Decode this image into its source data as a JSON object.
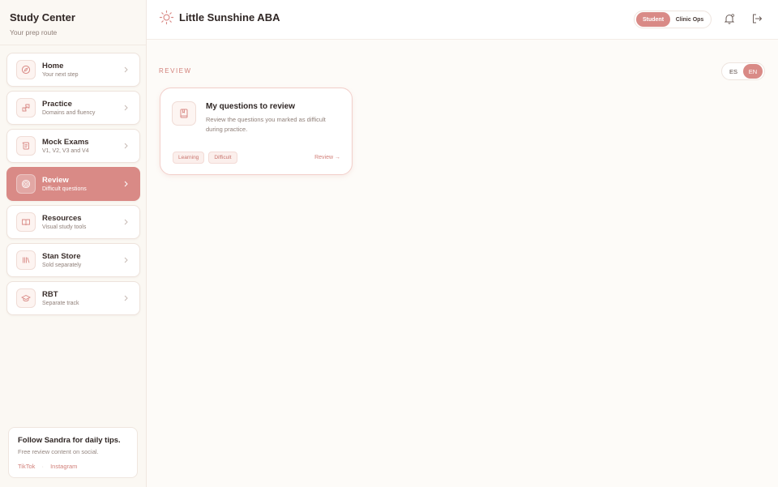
{
  "sidebar": {
    "title": "Study Center",
    "subtitle": "Your prep route",
    "items": [
      {
        "label": "Home",
        "desc": "Your next step",
        "icon": "compass-icon"
      },
      {
        "label": "Practice",
        "desc": "Domains and fluency",
        "icon": "puzzle-icon"
      },
      {
        "label": "Mock Exams",
        "desc": "V1, V2, V3 and V4",
        "icon": "scroll-icon"
      },
      {
        "label": "Review",
        "desc": "Difficult questions",
        "icon": "target-icon",
        "active": true
      },
      {
        "label": "Resources",
        "desc": "Visual study tools",
        "icon": "open-book-icon"
      },
      {
        "label": "Stan Store",
        "desc": "Sold separately",
        "icon": "library-icon"
      },
      {
        "label": "RBT",
        "desc": "Separate track",
        "icon": "graduation-cap-icon"
      }
    ],
    "promo": {
      "title": "Follow Sandra for daily tips.",
      "subtitle": "Free review content on social.",
      "link_tiktok": "TikTok",
      "separator": "·",
      "link_instagram": "Instagram"
    }
  },
  "topbar": {
    "brand": "Little Sunshine ABA",
    "role_student": "Student",
    "role_clinic": "Clinic Ops"
  },
  "main": {
    "section_label": "REVIEW",
    "lang_es": "ES",
    "lang_en": "EN",
    "card": {
      "title": "My questions to review",
      "description": "Review the questions you marked as difficult during practice.",
      "tags": [
        "Learning",
        "Difficult"
      ],
      "link": "Review →"
    }
  },
  "colors": {
    "accent": "#d98a86",
    "accent_text": "#d2807a",
    "background": "#fdfbf8"
  }
}
